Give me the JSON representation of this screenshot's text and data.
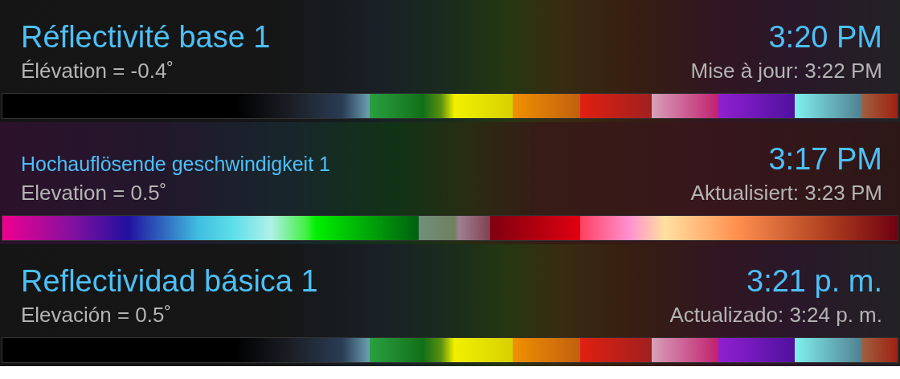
{
  "panels": [
    {
      "kind": "reflectivity",
      "title": "Réflectivité base 1",
      "time": "3:20 PM",
      "elevation": "Élévation = -0.4˚",
      "updated": "Mise à jour: 3:22 PM"
    },
    {
      "kind": "velocity",
      "title": "Hochauflösende geschwindigkeit 1",
      "time": "3:17 PM",
      "elevation": "Elevation = 0.5˚",
      "updated": "Aktualisiert: 3:23 PM"
    },
    {
      "kind": "reflectivity",
      "title": "Reflectividad básica 1",
      "time": "3:21 p. m.",
      "elevation": "Elevación = 0.5˚",
      "updated": "Actualizado: 3:24 p. m."
    }
  ]
}
